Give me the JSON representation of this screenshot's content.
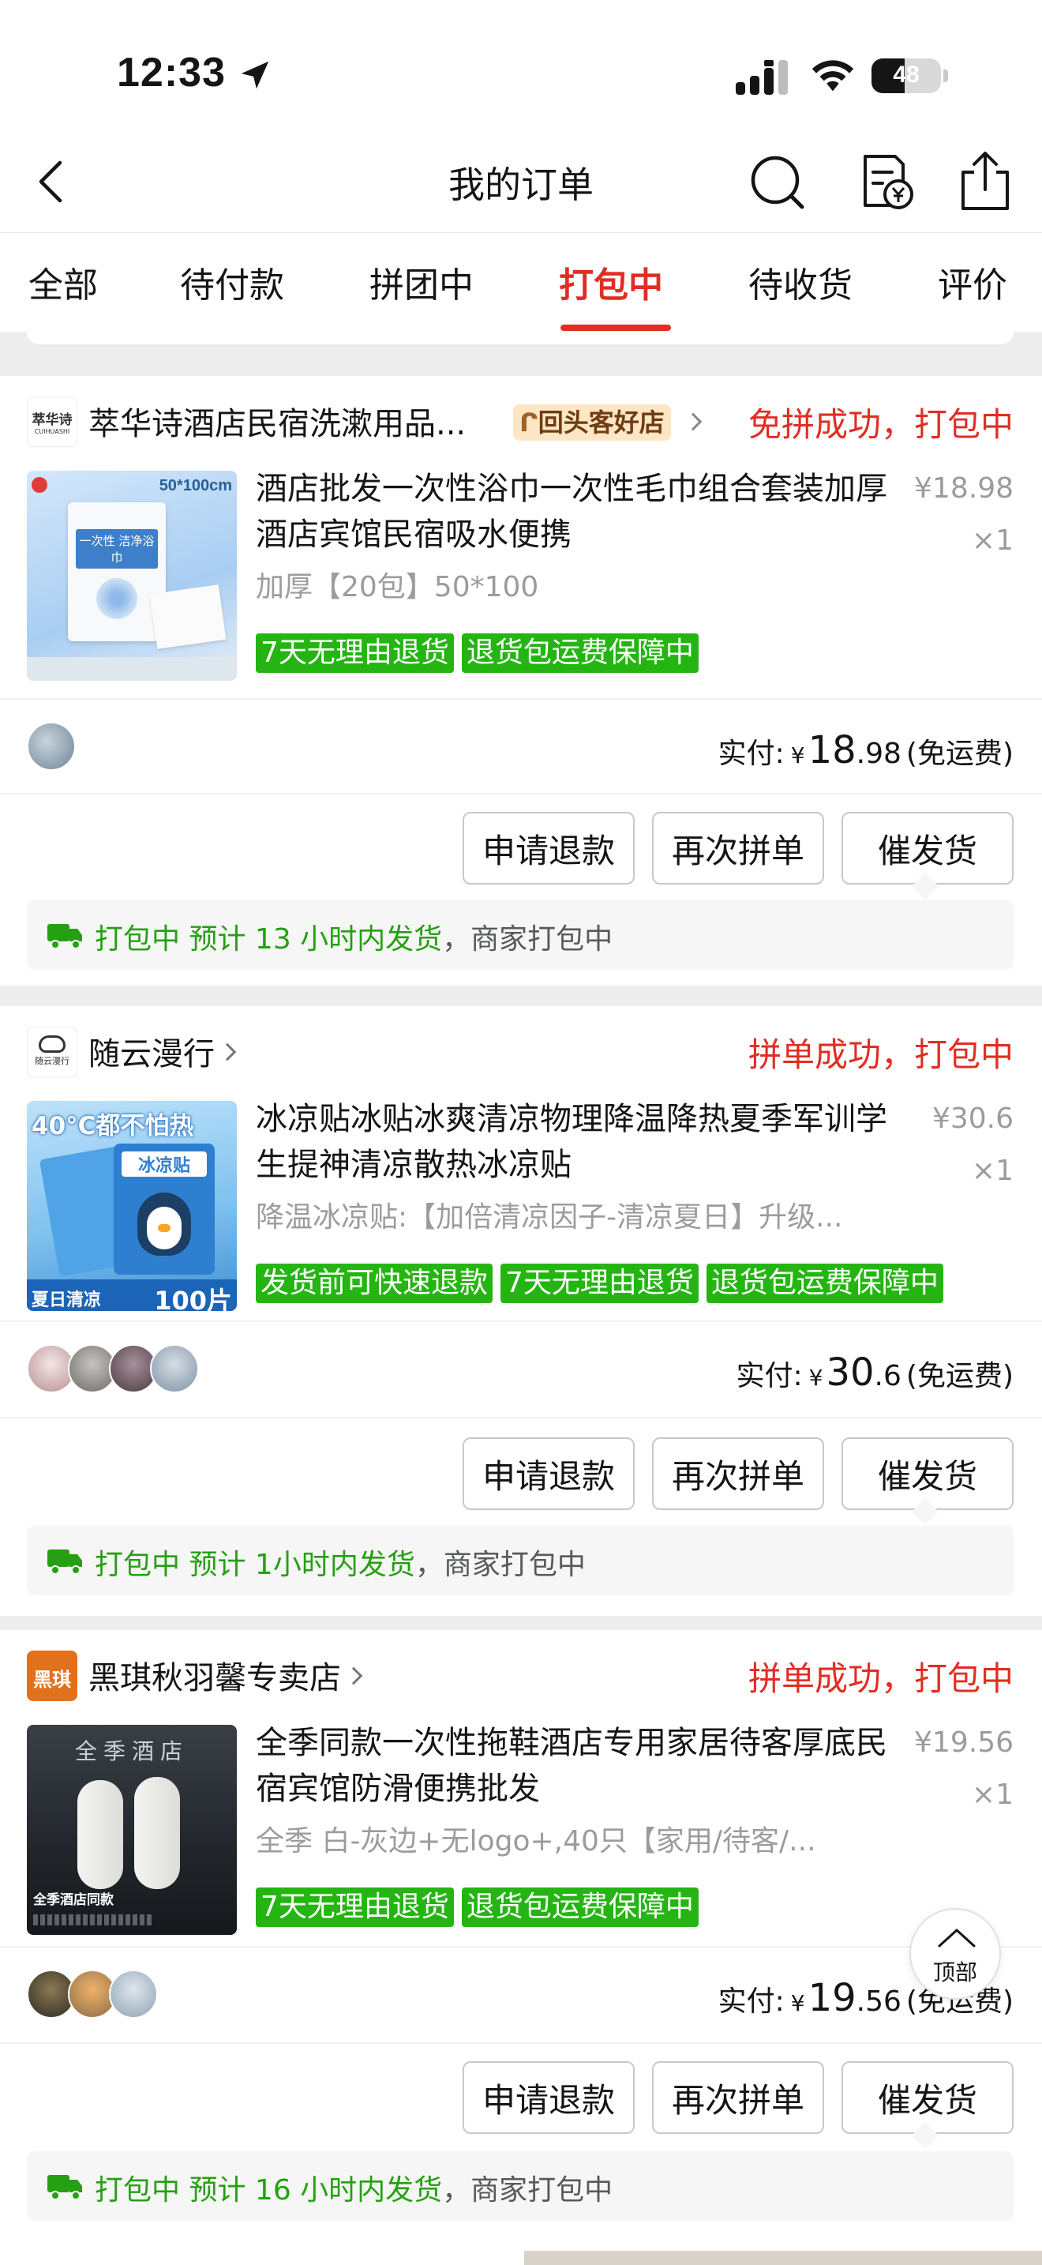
{
  "status_bar": {
    "time": "12:33",
    "battery_text": "48",
    "battery_level": 0.48
  },
  "header": {
    "title": "我的订单",
    "icons": [
      "back-icon",
      "search-icon",
      "bill-icon",
      "share-icon"
    ]
  },
  "tabs": [
    {
      "label": "全部",
      "active": false
    },
    {
      "label": "待付款",
      "active": false
    },
    {
      "label": "拼团中",
      "active": false
    },
    {
      "label": "打包中",
      "active": true
    },
    {
      "label": "待收货",
      "active": false
    },
    {
      "label": "评价",
      "active": false
    }
  ],
  "orders": [
    {
      "shop_logo_text": "萃华诗",
      "shop_logo_sub": "CUIHUASHI",
      "shop_name": "萃华诗酒店民宿洗漱用品...",
      "badge": "回头客好店",
      "status": "免拼成功，打包中",
      "image_label": "50*100cm",
      "image_pack_text": "一次性 洁净浴巾",
      "title": "酒店批发一次性浴巾一次性毛巾组合套装加厚酒店宾馆民宿吸水便携",
      "spec": "加厚【20包】50*100",
      "price": "¥18.98",
      "qty": "×1",
      "tags": [
        "7天无理由退货",
        "退货包运费保障中"
      ],
      "paid_label": "实付:",
      "paid_yen": "¥",
      "paid_int": "18",
      "paid_dec": ".98",
      "paid_note": "(免运费)",
      "buttons": {
        "refund": "申请退款",
        "again": "再次拼单",
        "urge": "催发货"
      },
      "ship_status": "打包中",
      "ship_eta": "预计 13 小时内发货",
      "ship_note": "，商家打包中"
    },
    {
      "shop_logo_text": "随云漫行",
      "shop_name": "随云漫行",
      "status": "拼单成功，打包中",
      "image_top_text": "40°C都不怕热",
      "image_pack_text": "冰凉贴",
      "image_bottom_left": "夏日清凉",
      "image_bottom_right": "100片",
      "title": "冰凉贴冰贴冰爽清凉物理降温降热夏季军训学生提神清凉散热冰凉贴",
      "spec": "降温冰凉贴:【加倍清凉因子-清凉夏日】升级...",
      "price": "¥30.6",
      "qty": "×1",
      "tags": [
        "发货前可快速退款",
        "7天无理由退货",
        "退货包运费保障中"
      ],
      "paid_label": "实付:",
      "paid_yen": "¥",
      "paid_int": "30",
      "paid_dec": ".6",
      "paid_note": "(免运费)",
      "buttons": {
        "refund": "申请退款",
        "again": "再次拼单",
        "urge": "催发货"
      },
      "ship_status": "打包中",
      "ship_eta": "预计 1小时内发货",
      "ship_note": "，商家打包中"
    },
    {
      "shop_logo_text": "黑琪",
      "shop_name": "黑琪秋羽馨专卖店",
      "status": "拼单成功，打包中",
      "image_top_text": "全季酒店",
      "image_bottom_left": "全季酒店同款",
      "title": "全季同款一次性拖鞋酒店专用家居待客厚底民宿宾馆防滑便携批发",
      "spec": "全季 白-灰边+无logo+,40只【家用/待客/...",
      "price": "¥19.56",
      "qty": "×1",
      "tags": [
        "7天无理由退货",
        "退货包运费保障中"
      ],
      "paid_label": "实付:",
      "paid_yen": "¥",
      "paid_int": "19",
      "paid_dec": ".56",
      "paid_note": "(免运费)",
      "buttons": {
        "refund": "申请退款",
        "again": "再次拼单",
        "urge": "催发货"
      },
      "ship_status": "打包中",
      "ship_eta": "预计 16 小时内发货",
      "ship_note": "，商家打包中"
    }
  ],
  "scroll_top": {
    "label": "顶部"
  },
  "colors": {
    "accent": "#e02e24",
    "tag_green": "#25b513",
    "ship_green": "#25a012",
    "badge_bg": "#fde6c4"
  }
}
